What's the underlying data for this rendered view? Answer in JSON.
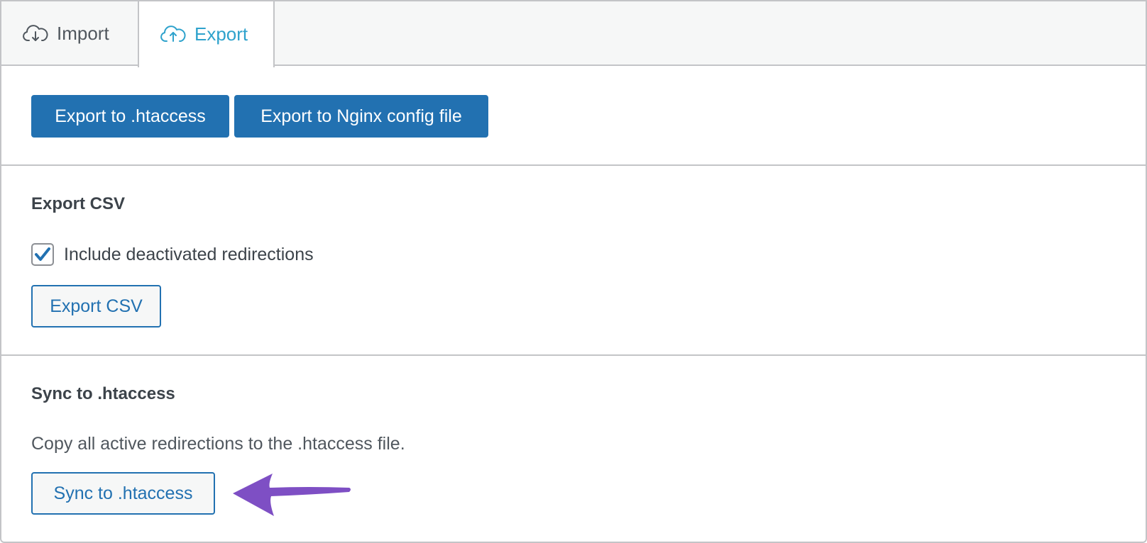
{
  "tabs": {
    "import_label": "Import",
    "export_label": "Export"
  },
  "export_server": {
    "htaccess_button": "Export to .htaccess",
    "nginx_button": "Export to Nginx config file"
  },
  "export_csv": {
    "heading": "Export CSV",
    "checkbox_label": "Include deactivated redirections",
    "checkbox_checked": true,
    "button": "Export CSV"
  },
  "sync": {
    "heading": "Sync to .htaccess",
    "description": "Copy all active redirections to the .htaccess file.",
    "button": "Sync to .htaccess"
  },
  "colors": {
    "primary": "#2271b1",
    "active_tab": "#2ea2cc",
    "annotation_arrow": "#7e4fc4"
  }
}
